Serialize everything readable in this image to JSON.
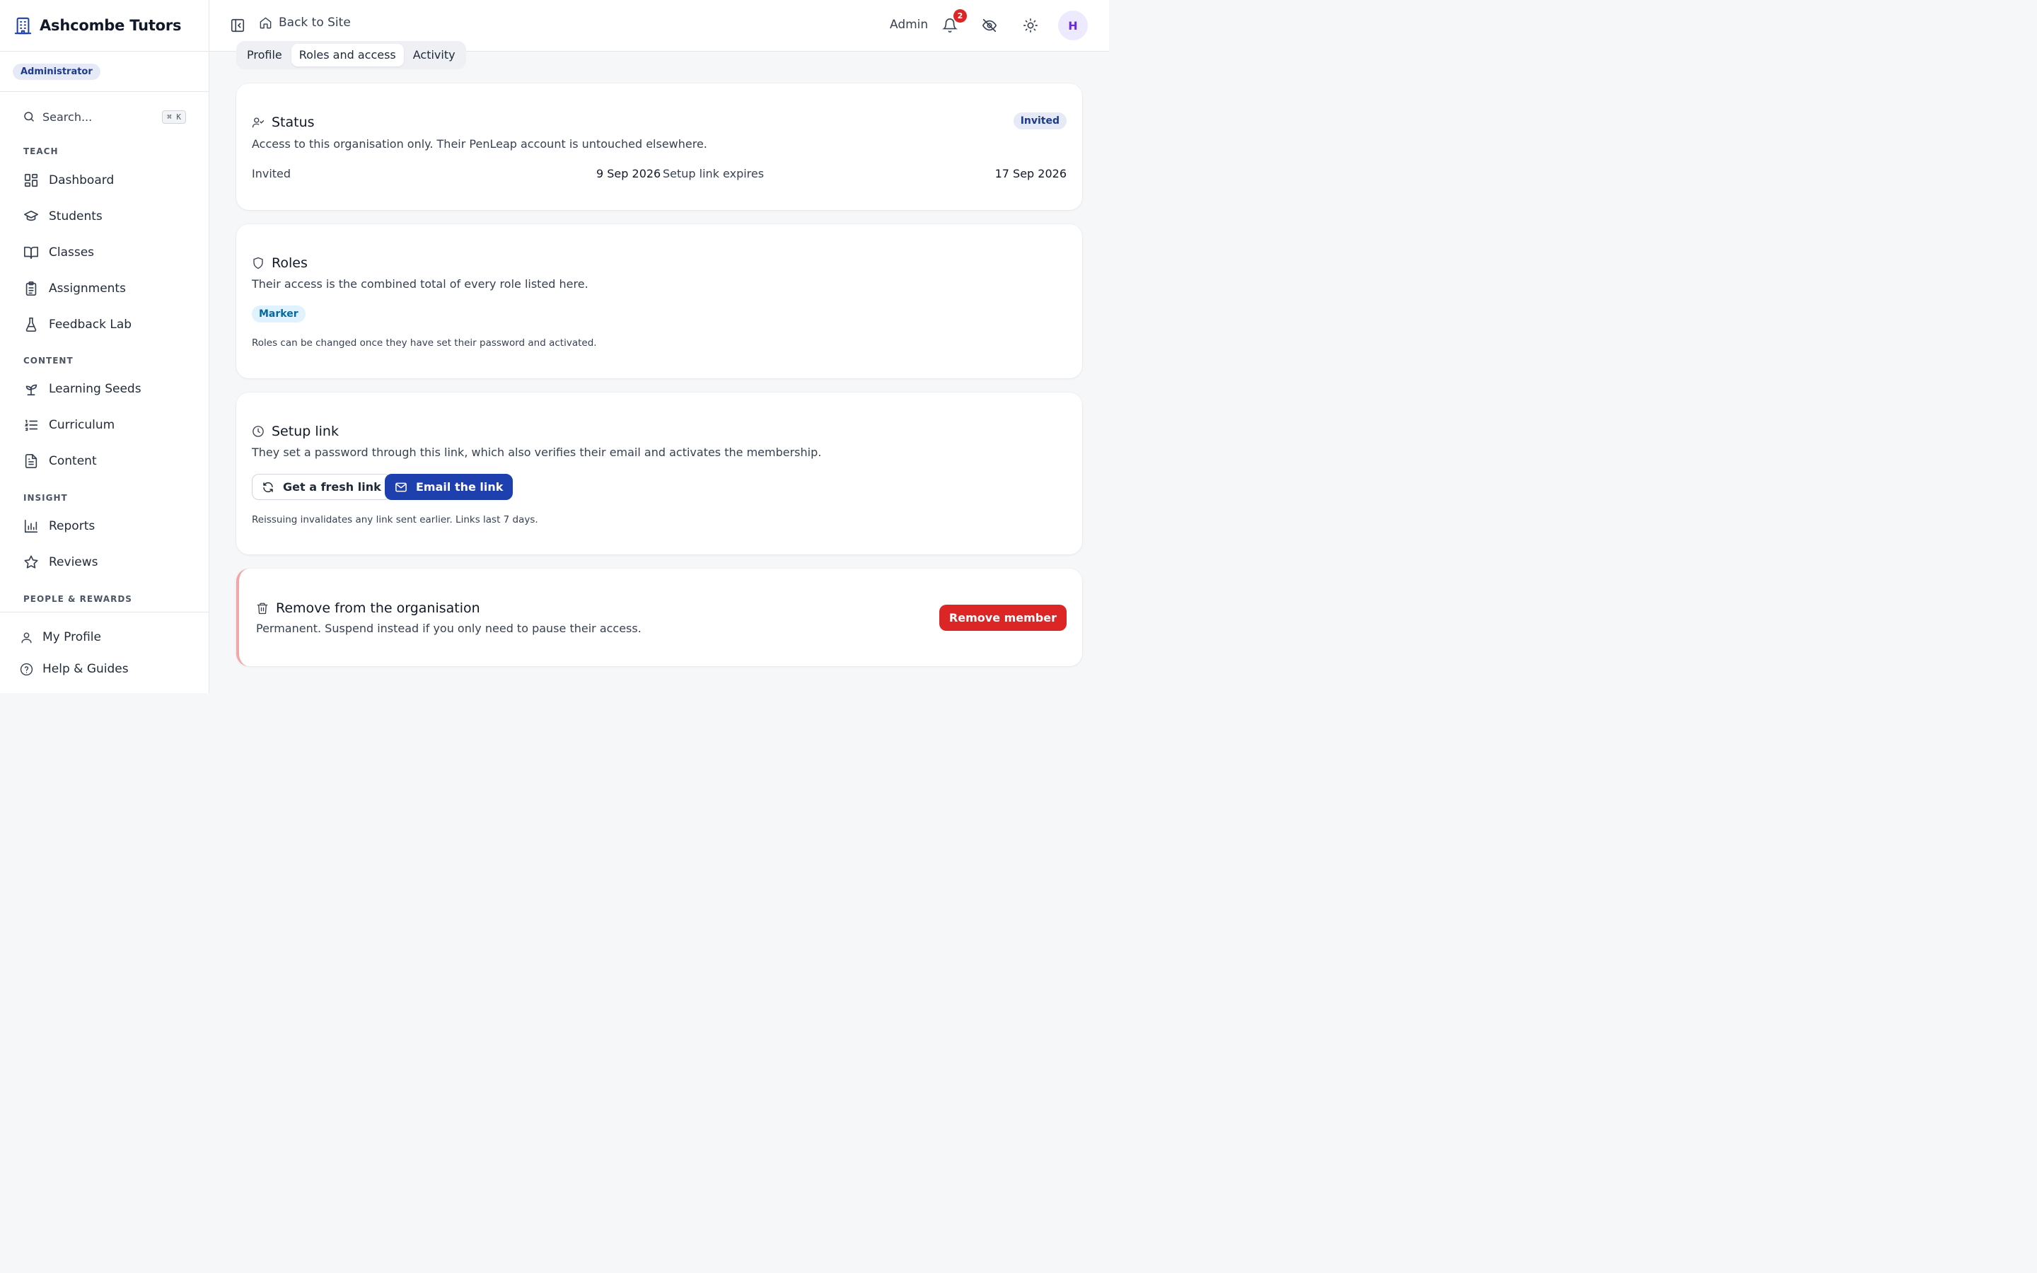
{
  "brand": {
    "name": "Ashcombe Tutors",
    "role_badge": "Administrator"
  },
  "search": {
    "placeholder": "Search...",
    "shortcut": "⌘ K"
  },
  "sidebar": {
    "sections": [
      "TEACH",
      "CONTENT",
      "INSIGHT",
      "PEOPLE & REWARDS"
    ],
    "teach": [
      {
        "label": "Dashboard",
        "icon": "dashboard-icon"
      },
      {
        "label": "Students",
        "icon": "graduation-cap-icon"
      },
      {
        "label": "Classes",
        "icon": "book-open-icon"
      },
      {
        "label": "Assignments",
        "icon": "clipboard-icon"
      },
      {
        "label": "Feedback Lab",
        "icon": "flask-icon"
      }
    ],
    "content": [
      {
        "label": "Learning Seeds",
        "icon": "sprout-icon"
      },
      {
        "label": "Curriculum",
        "icon": "list-ordered-icon"
      },
      {
        "label": "Content",
        "icon": "file-text-icon"
      }
    ],
    "insight": [
      {
        "label": "Reports",
        "icon": "bar-chart-icon"
      },
      {
        "label": "Reviews",
        "icon": "star-icon"
      }
    ],
    "footer": [
      {
        "label": "My Profile",
        "icon": "user-icon"
      },
      {
        "label": "Help & Guides",
        "icon": "help-circle-icon"
      }
    ]
  },
  "topbar": {
    "back_label": "Back to Site",
    "admin_label": "Admin",
    "notification_count": "2",
    "avatar_initial": "H"
  },
  "tabs": [
    "Profile",
    "Roles and access",
    "Activity"
  ],
  "status_card": {
    "title": "Status",
    "badge": "Invited",
    "description": "Access to this organisation only. Their PenLeap account is untouched elsewhere.",
    "invited_label": "Invited",
    "invited_date": "9 Sep 2026",
    "expires_label": "Setup link expires",
    "expires_date": "17 Sep 2026"
  },
  "roles_card": {
    "title": "Roles",
    "description": "Their access is the combined total of every role listed here.",
    "role": "Marker",
    "note": "Roles can be changed once they have set their password and activated."
  },
  "setup_card": {
    "title": "Setup link",
    "description": "They set a password through this link, which also verifies their email and activates the membership.",
    "fresh_button": "Get a fresh link",
    "email_button": "Email the link",
    "note": "Reissuing invalidates any link sent earlier. Links last 7 days."
  },
  "remove_card": {
    "title": "Remove from the organisation",
    "description": "Permanent. Suspend instead if you only need to pause their access.",
    "button": "Remove member"
  },
  "colors": {
    "brand": "#1e40af",
    "danger": "#dc2626",
    "invited_badge_bg": "#e5eaf6",
    "marker_badge_bg": "#e0f2fe"
  }
}
